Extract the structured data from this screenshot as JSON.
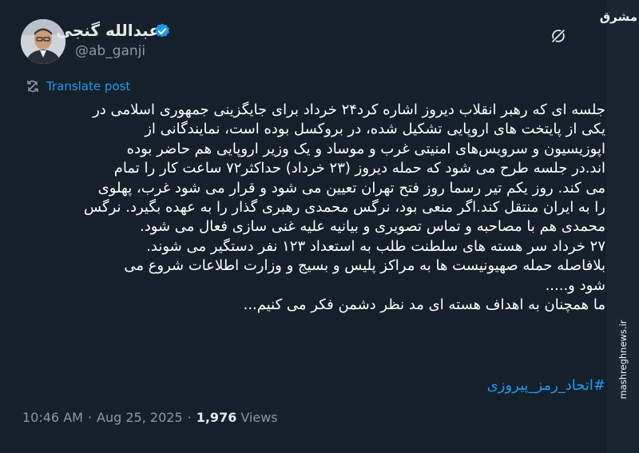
{
  "author": {
    "name": "عبدالله گنجی",
    "handle": "@ab_ganji",
    "verified": true
  },
  "translate_label": "Translate post",
  "tweet_lines": [
    "جلسه ای که رهبر انقلاب دیروز اشاره کرد۲۴ خرداد برای جایگزینی جمهوری اسلامی در",
    "یکی از پایتخت های اروپایی تشکیل شده، در بروکسل بوده است، نمایندگانی از",
    "اپوزیسیون و سرویس‌های امنیتی غرب و موساد و یک وزیر اروپایی هم حاضر بوده",
    "اند.در جلسه طرح می شود که حمله دیروز (۲۳ خرداد) حداکثر۷۲ ساعت کار را تمام",
    "می کند. روز یکم تیر رسما روز فتح تهران تعیین می شود و قرار می شود غرب، پهلوی",
    "را به ایران منتقل کند.اگر منعی بود، نرگس محمدی رهبری گذار را به عهده بگیرد. نرگس",
    "محمدی هم با مصاحبه و تماس تصویری و بیانیه علیه غنی سازی فعال می شود.",
    "۲۷ خرداد سر هسته های سلطنت طلب به استعداد ۱۲۳ نفر دستگیر می شوند.",
    "بلافاصله حمله صهیونیست ها به مراکز پلیس و بسیج و وزارت اطلاعات شروع می",
    "شود و.....",
    "ما همچنان به اهداف هسته ای مد نظر دشمن فکر می کنیم..."
  ],
  "hashtag": "#اتحاد_رمز_پیروزی",
  "meta": {
    "time": "10:46 AM",
    "separator": "·",
    "date": "Aug 25, 2025",
    "views_count": "1,976",
    "views_label": "Views"
  },
  "watermark": {
    "logo": "مشرق",
    "url": "mashreghnews.ir"
  },
  "colors": {
    "background": "#15202b",
    "text": "#ffffff",
    "secondary": "#8b98a5",
    "accent": "#1d9bf0"
  }
}
